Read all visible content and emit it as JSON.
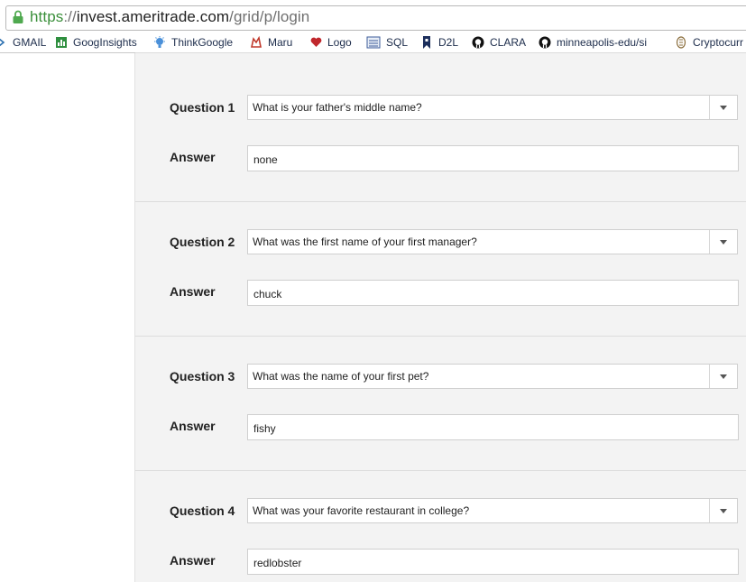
{
  "address_bar": {
    "scheme": "https",
    "separator": "://",
    "host": "invest.ameritrade.com",
    "path": "/grid/p/login"
  },
  "bookmarks": [
    {
      "label": "GMAIL",
      "icon": "arrow-icon"
    },
    {
      "label": "GoogInsights",
      "icon": "chart-icon"
    },
    {
      "label": "ThinkGoogle",
      "icon": "lightbulb-icon"
    },
    {
      "label": "Maru",
      "icon": "maru-icon"
    },
    {
      "label": "Logo",
      "icon": "heart-icon"
    },
    {
      "label": "SQL",
      "icon": "sql-icon"
    },
    {
      "label": "D2L",
      "icon": "bookmark-icon"
    },
    {
      "label": "CLARA",
      "icon": "github-icon"
    },
    {
      "label": "minneapolis-edu/si",
      "icon": "github-icon"
    },
    {
      "label": "Cryptocurr",
      "icon": "coin-icon"
    }
  ],
  "questions": [
    {
      "label": "Question 1",
      "question": "What is your father's middle name?",
      "answer_label": "Answer",
      "answer": "none"
    },
    {
      "label": "Question 2",
      "question": "What was the first name of your first manager?",
      "answer_label": "Answer",
      "answer": "chuck"
    },
    {
      "label": "Question 3",
      "question": "What was the name of your first pet?",
      "answer_label": "Answer",
      "answer": "fishy"
    },
    {
      "label": "Question 4",
      "question": "What was your favorite restaurant in college?",
      "answer_label": "Answer",
      "answer": "redlobster"
    }
  ]
}
